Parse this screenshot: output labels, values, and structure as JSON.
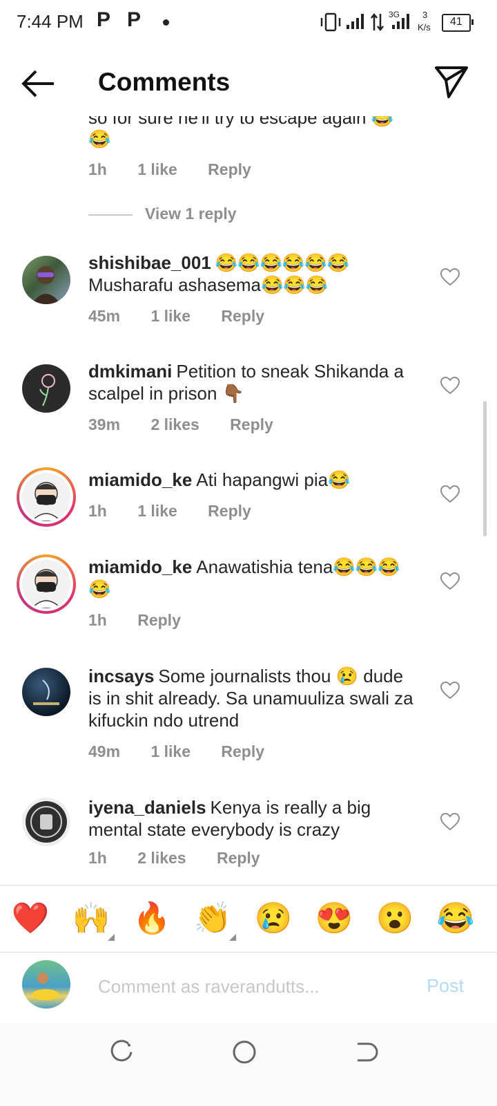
{
  "status_bar": {
    "time": "7:44 PM",
    "app_icons": [
      "P",
      "P"
    ],
    "network_speed": "3\nK/s",
    "network_speed_value": "3",
    "network_speed_unit": "K/s",
    "network_type": "3G",
    "battery": "41"
  },
  "header": {
    "title": "Comments"
  },
  "partial_comment": {
    "text": "so for sure he'll try to escape again 😂",
    "emoji": "😂",
    "time": "1h",
    "likes": "1 like",
    "reply": "Reply",
    "view_replies": "View 1 reply"
  },
  "comments": [
    {
      "username": "shishibae_001",
      "text": "😂😂😂😂😂😂 Musharafu ashasema😂😂😂",
      "time": "45m",
      "likes": "1 like",
      "reply": "Reply"
    },
    {
      "username": "dmkimani",
      "text": "Petition to sneak Shikanda a scalpel in prison 👇🏾",
      "time": "39m",
      "likes": "2 likes",
      "reply": "Reply"
    },
    {
      "username": "miamido_ke",
      "text": "Ati hapangwi pia😂",
      "time": "1h",
      "likes": "1 like",
      "reply": "Reply"
    },
    {
      "username": "miamido_ke",
      "text": "Anawatishia tena😂😂😂😂",
      "time": "1h",
      "likes": "",
      "reply": "Reply"
    },
    {
      "username": "incsays",
      "text": "Some journalists thou 😢 dude is in shit already. Sa unamuuliza swali za kifuckin ndo utrend",
      "time": "49m",
      "likes": "1 like",
      "reply": "Reply"
    },
    {
      "username": "iyena_daniels",
      "text": "Kenya is really a big mental state everybody is crazy",
      "time": "1h",
      "likes": "2 likes",
      "reply": "Reply"
    }
  ],
  "emoji_bar": [
    "❤️",
    "🙌",
    "🔥",
    "👏",
    "😢",
    "😍",
    "😮",
    "😂"
  ],
  "composer": {
    "placeholder": "Comment as raverandutts...",
    "post_label": "Post"
  },
  "colors": {
    "text": "#262626",
    "meta": "#8e8e8e",
    "post_disabled": "#b3d9f9",
    "divider": "#dbdbdb"
  }
}
